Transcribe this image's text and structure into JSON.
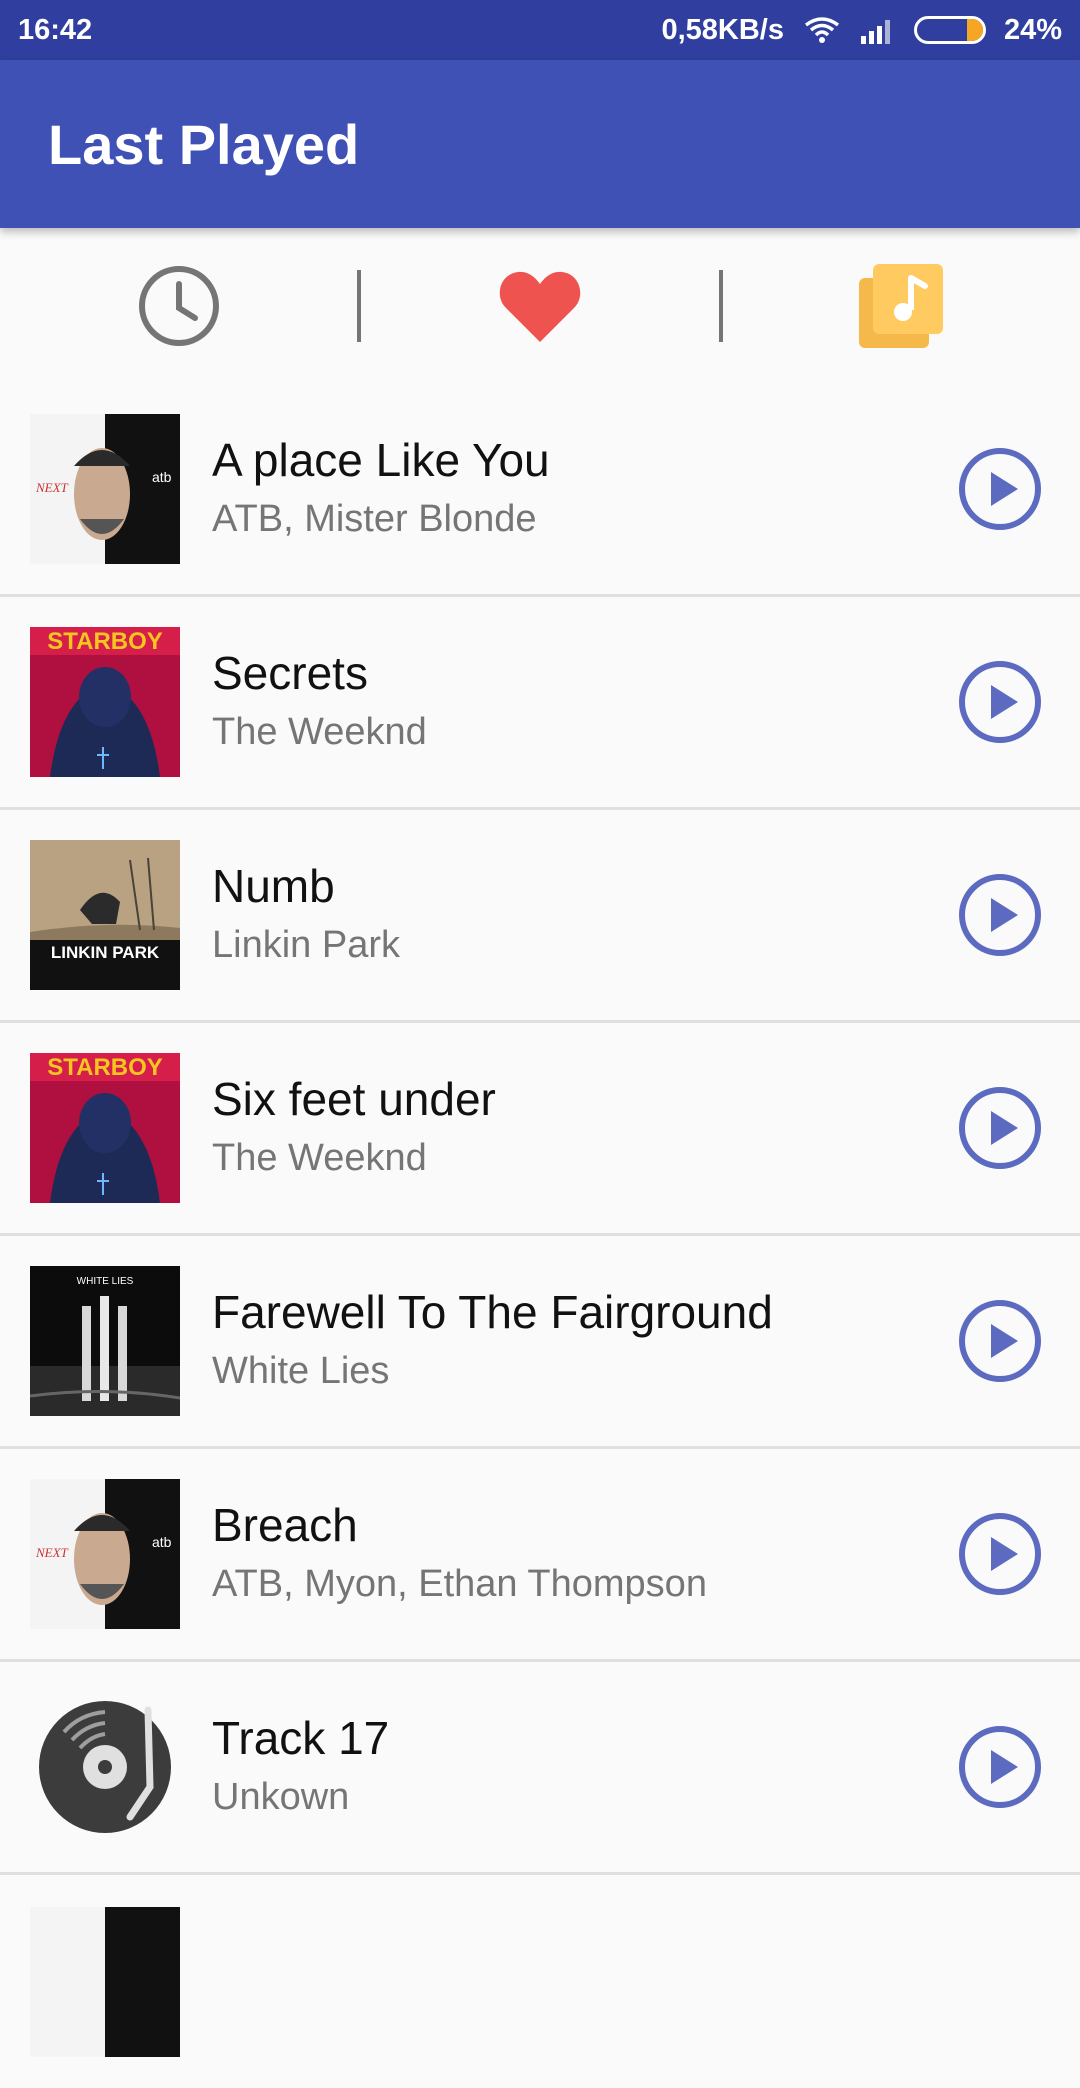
{
  "status_bar": {
    "time": "16:42",
    "net_speed": "0,58KB/s",
    "battery_pct": "24%",
    "battery_level": 0.24,
    "colors": {
      "background": "#303f9f"
    }
  },
  "app_bar": {
    "title": "Last Played",
    "color": "#3f51b5"
  },
  "tabs": [
    {
      "icon": "clock-icon",
      "color": "#757575"
    },
    {
      "icon": "heart-icon",
      "color": "#ef5350"
    },
    {
      "icon": "music-library-icon",
      "color": "#ffca5f"
    }
  ],
  "tracks": [
    {
      "title": "A place Like You",
      "artist": "ATB, Mister Blonde",
      "art": "atb-next-cover"
    },
    {
      "title": "Secrets",
      "artist": "The Weeknd",
      "art": "starboy-cover"
    },
    {
      "title": "Numb",
      "artist": "Linkin Park",
      "art": "linkin-park-cover"
    },
    {
      "title": "Six feet under",
      "artist": "The Weeknd",
      "art": "starboy-cover"
    },
    {
      "title": "Farewell To The Fairground",
      "artist": "White Lies",
      "art": "white-lies-cover"
    },
    {
      "title": "Breach",
      "artist": "ATB, Myon, Ethan Thompson",
      "art": "atb-next-cover"
    },
    {
      "title": "Track 17",
      "artist": "Unkown",
      "art": "vinyl-record-icon"
    }
  ],
  "covers": {
    "starboy_label": "STARBOY",
    "linkin_label": "LINKIN PARK",
    "white_lies_label": "WHITE LIES",
    "atb_label": "atb",
    "next_label": "NEXT"
  },
  "accent": "#5c6bc0"
}
